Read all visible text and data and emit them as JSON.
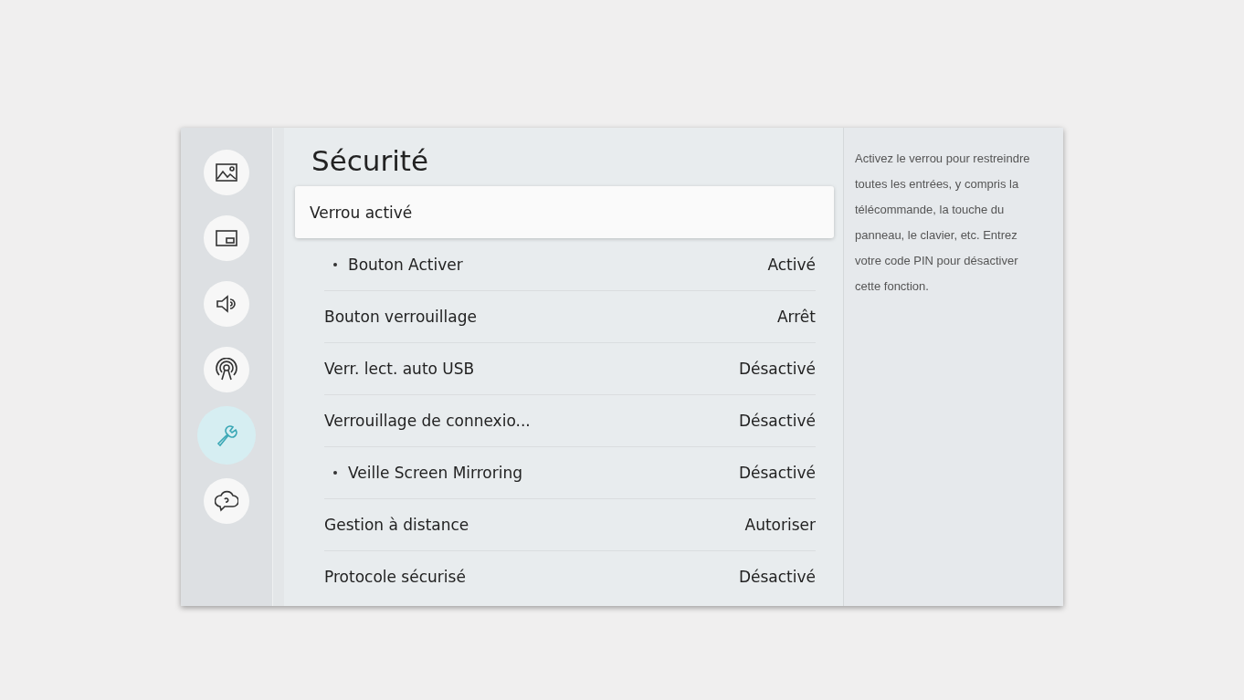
{
  "sidebar": {
    "items": [
      {
        "kind": "picture",
        "selected": false
      },
      {
        "kind": "pip",
        "selected": false
      },
      {
        "kind": "sound",
        "selected": false
      },
      {
        "kind": "broadcast",
        "selected": false
      },
      {
        "kind": "wrench",
        "selected": true
      },
      {
        "kind": "help",
        "selected": false
      }
    ]
  },
  "title": "Sécurité",
  "rows": [
    {
      "kind": "header",
      "label": "Verrou activé",
      "selected": true
    },
    {
      "kind": "sub",
      "label": "Bouton Activer",
      "value": "Activé",
      "selected": false
    },
    {
      "kind": "item",
      "label": "Bouton verrouillage",
      "value": "Arrêt",
      "selected": false
    },
    {
      "kind": "item",
      "label": "Verr. lect. auto USB",
      "value": "Désactivé",
      "selected": false
    },
    {
      "kind": "item",
      "label": "Verrouillage de connexio...",
      "value": "Désactivé",
      "selected": false
    },
    {
      "kind": "sub",
      "label": "Veille Screen Mirroring",
      "value": "Désactivé",
      "selected": false
    },
    {
      "kind": "item",
      "label": "Gestion à distance",
      "value": "Autoriser",
      "selected": false
    },
    {
      "kind": "item",
      "label": "Protocole sécurisé",
      "value": "Désactivé",
      "selected": false
    }
  ],
  "description": "Activez le verrou pour restreindre toutes les entrées, y compris la télécommande, la touche du panneau, le clavier, etc. Entrez votre code PIN pour désactiver cette fonction."
}
